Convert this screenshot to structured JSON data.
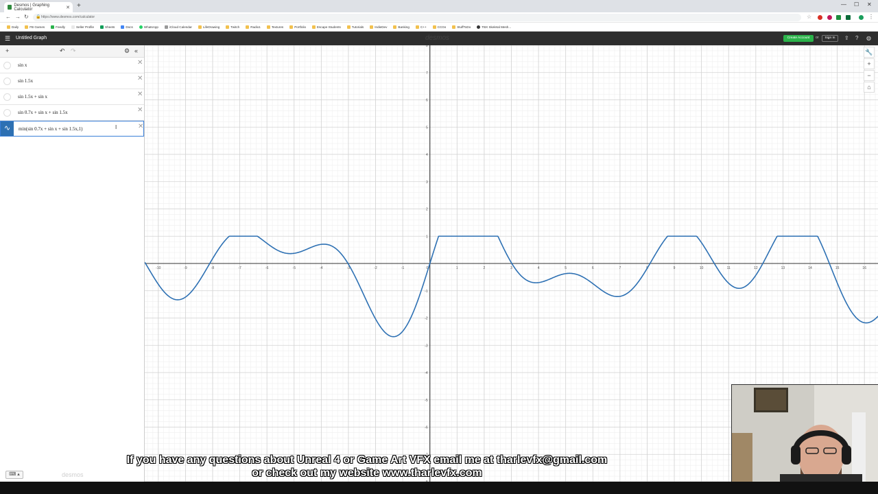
{
  "browser": {
    "tab_title": "Desmos | Graphing Calculator",
    "url": "https://www.desmos.com/calculator",
    "bookmarks": [
      "Daily",
      "FB Games",
      "Feedly",
      "Seller Profile",
      "Sheets",
      "Docs",
      "WhatsApp",
      "iCloud Calendar",
      "LifeDrawing",
      "Twitch",
      "Radio1",
      "Textures",
      "Portfolio",
      "Escape Students",
      "Tutorials",
      "IndieDev",
      "Banking",
      "C++",
      "CCGs",
      "StuffToDo",
      "TBX Skeletal Mesh..."
    ]
  },
  "header": {
    "graph_title": "Untitled Graph",
    "brand": "desmos",
    "create_account": "Create Account",
    "or": "or",
    "sign_in": "Sign In"
  },
  "expressions": [
    {
      "text": "sin x",
      "color": "",
      "active": false
    },
    {
      "text": "sin 1.5x",
      "color": "",
      "active": false
    },
    {
      "text": "sin 1.5x + sin x",
      "color": "",
      "active": false
    },
    {
      "text": "sin 0.7x + sin x + sin 1.5x",
      "color": "",
      "active": false
    },
    {
      "text": "min(sin 0.7x + sin x + sin 1.5x,1)",
      "color": "#2d70b3",
      "active": true
    }
  ],
  "panel": {
    "powered_by": "desmos"
  },
  "graph": {
    "x_range": [
      -10.5,
      16.5
    ],
    "y_range": [
      -8,
      8
    ],
    "x_ticks": [
      -10,
      -9,
      -8,
      -7,
      -6,
      -5,
      -4,
      -3,
      -2,
      -1,
      0,
      1,
      2,
      3,
      4,
      5,
      6,
      7,
      8,
      9,
      10,
      11,
      12,
      13,
      14,
      15,
      16
    ],
    "y_ticks": [
      -8,
      -7,
      -6,
      -5,
      -4,
      -3,
      -2,
      -1,
      1,
      2,
      3,
      4,
      5,
      6,
      7,
      8
    ],
    "curve_color": "#2d70b3",
    "function": "min(sin(0.7x)+sin(x)+sin(1.5x),1)"
  },
  "caption": {
    "line1": "If you have any questions about Unreal 4 or Game Art VFX email me at tharlevfx@gmail.com",
    "line2": "or check out my website www.tharlevfx.com"
  }
}
